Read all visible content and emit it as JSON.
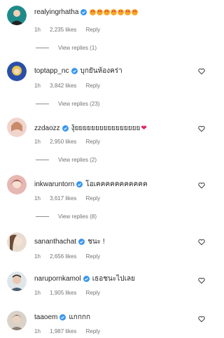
{
  "comments": [
    {
      "username": "realyingrhatha",
      "text": "",
      "emoji_count": 7,
      "time": "1h",
      "likes": "2,235 likes",
      "reply": "Reply",
      "view_replies": "View replies (1)",
      "avatar_color": "#1f8a8a"
    },
    {
      "username": "toptapp_nc",
      "text": "บุกยันห้องคร่า",
      "time": "1h",
      "likes": "3,842 likes",
      "reply": "Reply",
      "view_replies": "View replies (23)",
      "avatar_color": "#2a4fa8"
    },
    {
      "username": "zzdaozz",
      "text": "งุ้ยยยยยยยยยยยยยยยย",
      "heart": "❤",
      "time": "1h",
      "likes": "2,950 likes",
      "reply": "Reply",
      "view_replies": "View replies (2)",
      "avatar_color": "#e9b7a8"
    },
    {
      "username": "inkwaruntorn",
      "text": "โอเคคคคคคคคคคค",
      "time": "1h",
      "likes": "3,617 likes",
      "reply": "Reply",
      "view_replies": "View replies (8)",
      "avatar_color": "#d9a09a"
    },
    {
      "username": "sananthachat",
      "text": "ชนะ !",
      "time": "1h",
      "likes": "2,656 likes",
      "reply": "Reply",
      "avatar_color": "#c9b49c"
    },
    {
      "username": "narupornkamol",
      "text": "เธอชนะไปเลย",
      "time": "1h",
      "likes": "1,905 likes",
      "reply": "Reply",
      "avatar_color": "#8a9aa8"
    },
    {
      "username": "taaoem",
      "text": "แกกกก",
      "time": "1h",
      "likes": "1,987 likes",
      "reply": "Reply",
      "avatar_color": "#b8aca0"
    }
  ],
  "colors": {
    "verified": "#3897f0",
    "muted": "#737373",
    "text": "#262626"
  }
}
